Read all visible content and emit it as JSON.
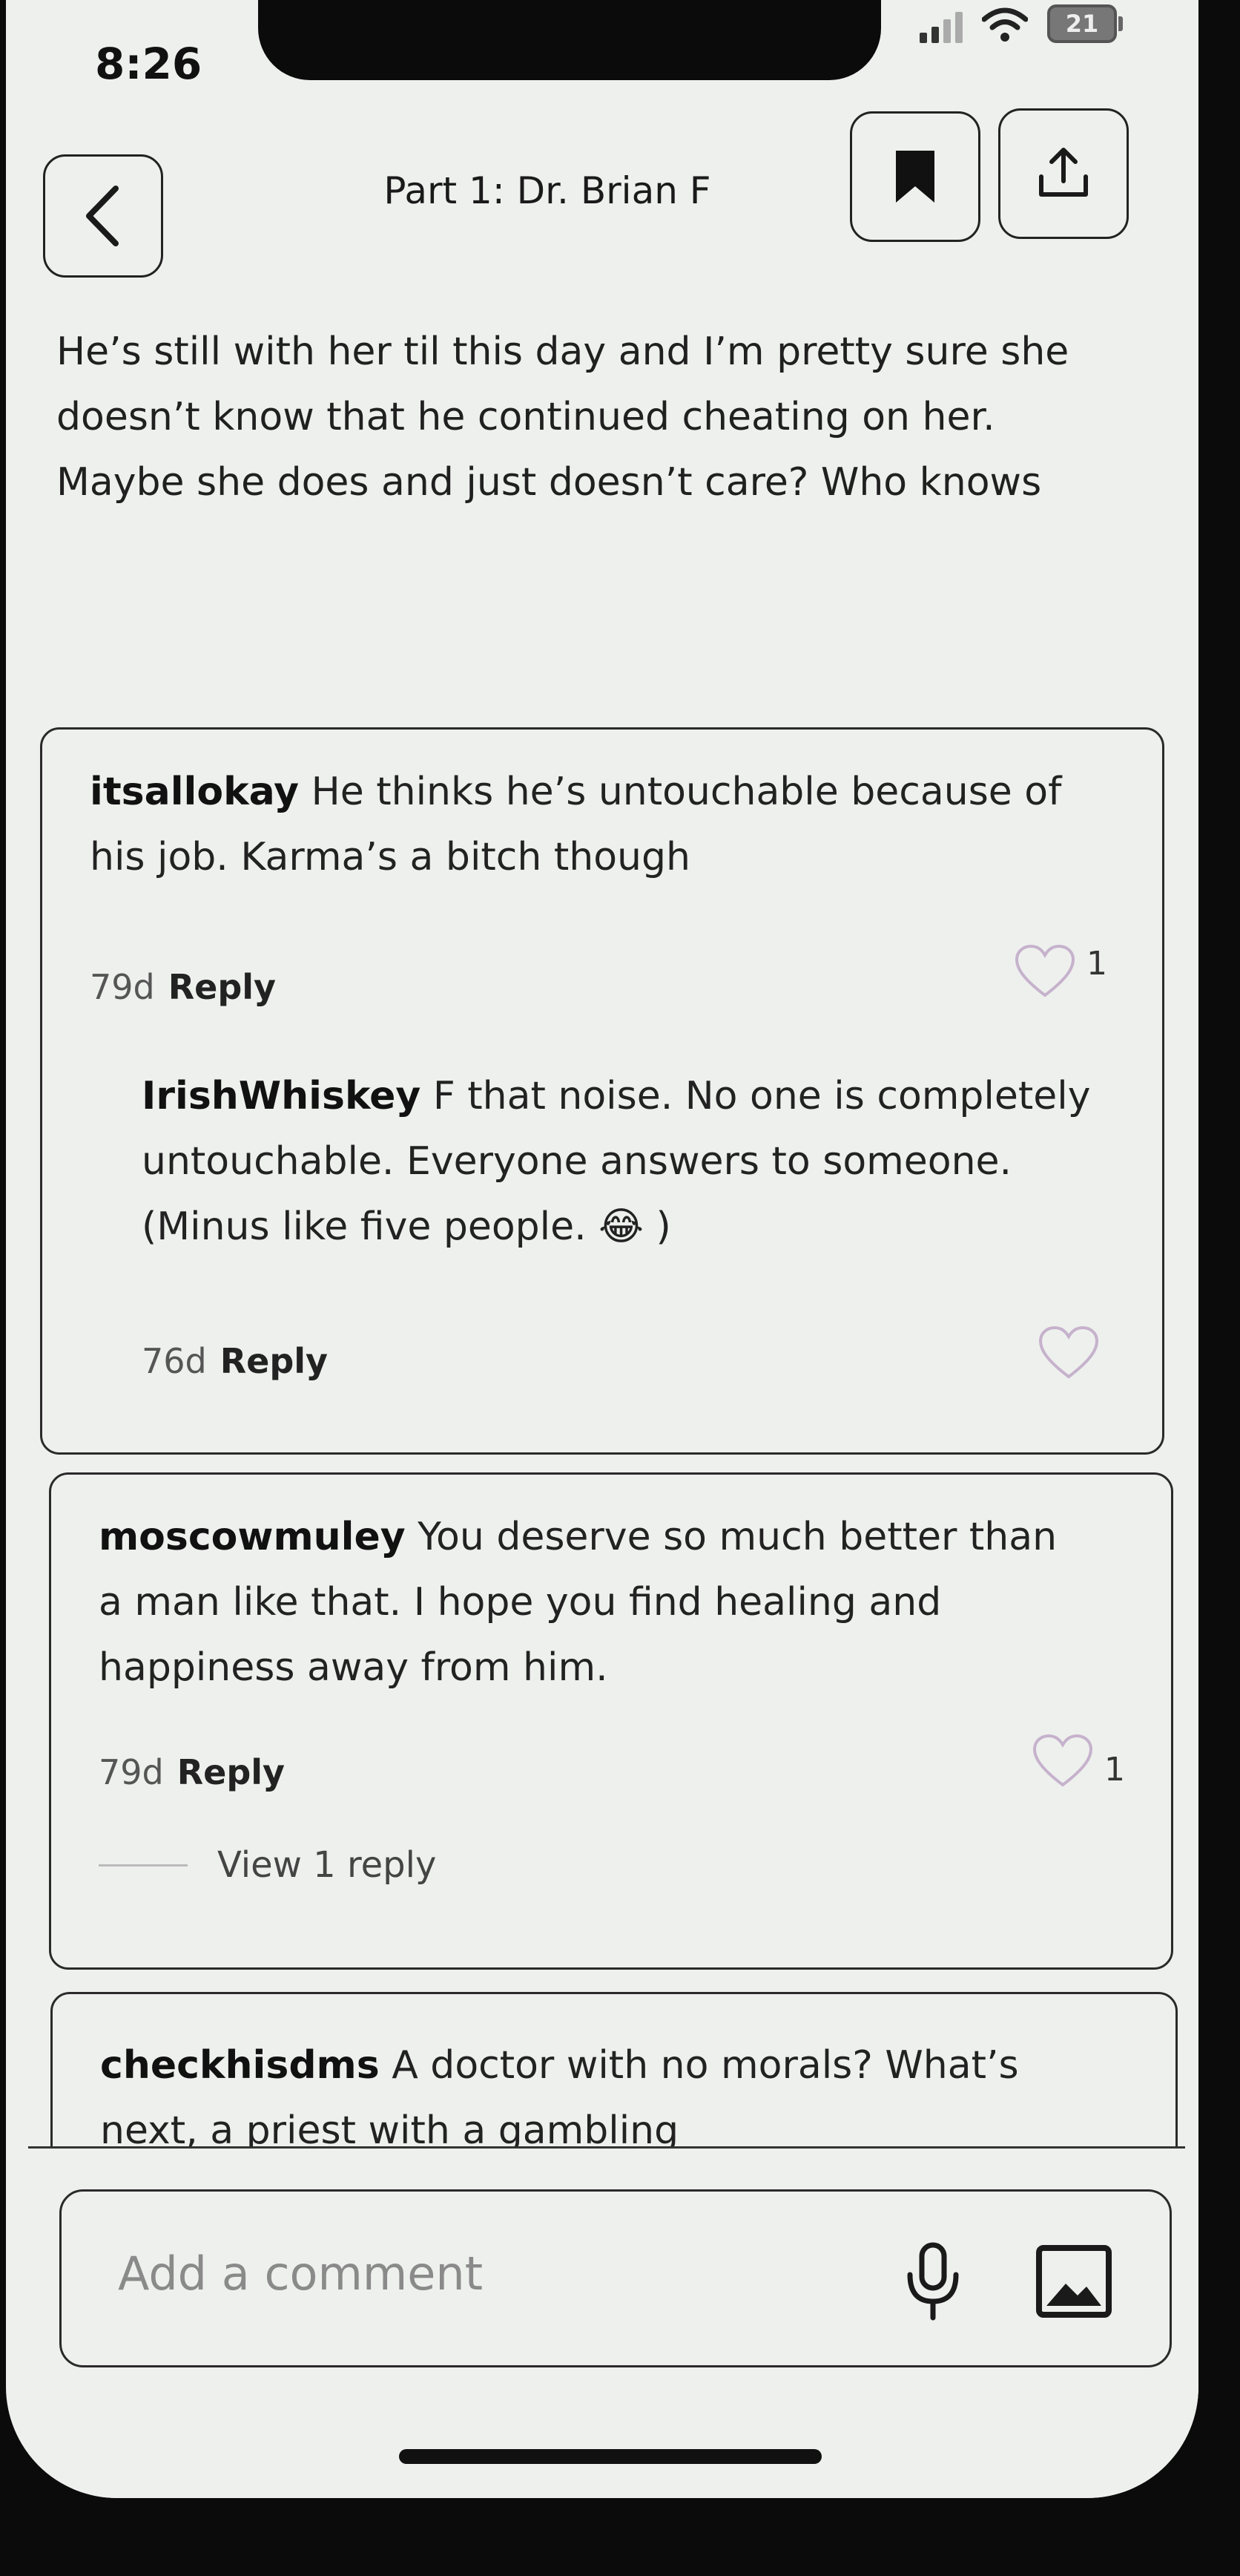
{
  "status_bar": {
    "time": "8:26",
    "battery": "21"
  },
  "header": {
    "title": "Part 1: Dr. Brian F"
  },
  "story": {
    "text": "He’s still with her til this day and I’m pretty sure she doesn’t know that he continued cheating on her. Maybe she does and just doesn’t care? Who knows"
  },
  "comments": [
    {
      "username": "itsallokay",
      "text": "He thinks he’s untouchable because of his job. Karma’s a bitch though",
      "age": "79d",
      "reply_label": "Reply",
      "likes": "1"
    },
    {
      "username": "IrishWhiskey",
      "text": "F that noise. No one is completely untouchable. Everyone answers to someone. (Minus like five people. 😂 )",
      "age": "76d",
      "reply_label": "Reply",
      "likes": ""
    },
    {
      "username": "moscowmuley",
      "text": "You deserve so much better than a man like that. I hope you find healing and happiness away from him.",
      "age": "79d",
      "reply_label": "Reply",
      "likes": "1",
      "view_replies": "View 1 reply"
    },
    {
      "username": "checkhisdms",
      "text": "A doctor with no morals? What’s next, a priest with a gambling"
    }
  ],
  "composer": {
    "placeholder": "Add a comment"
  },
  "icons": {
    "back": "chevron-left-icon",
    "bookmark": "bookmark-icon",
    "share": "share-icon",
    "like": "heart-icon",
    "mic": "microphone-icon",
    "image": "image-icon"
  }
}
